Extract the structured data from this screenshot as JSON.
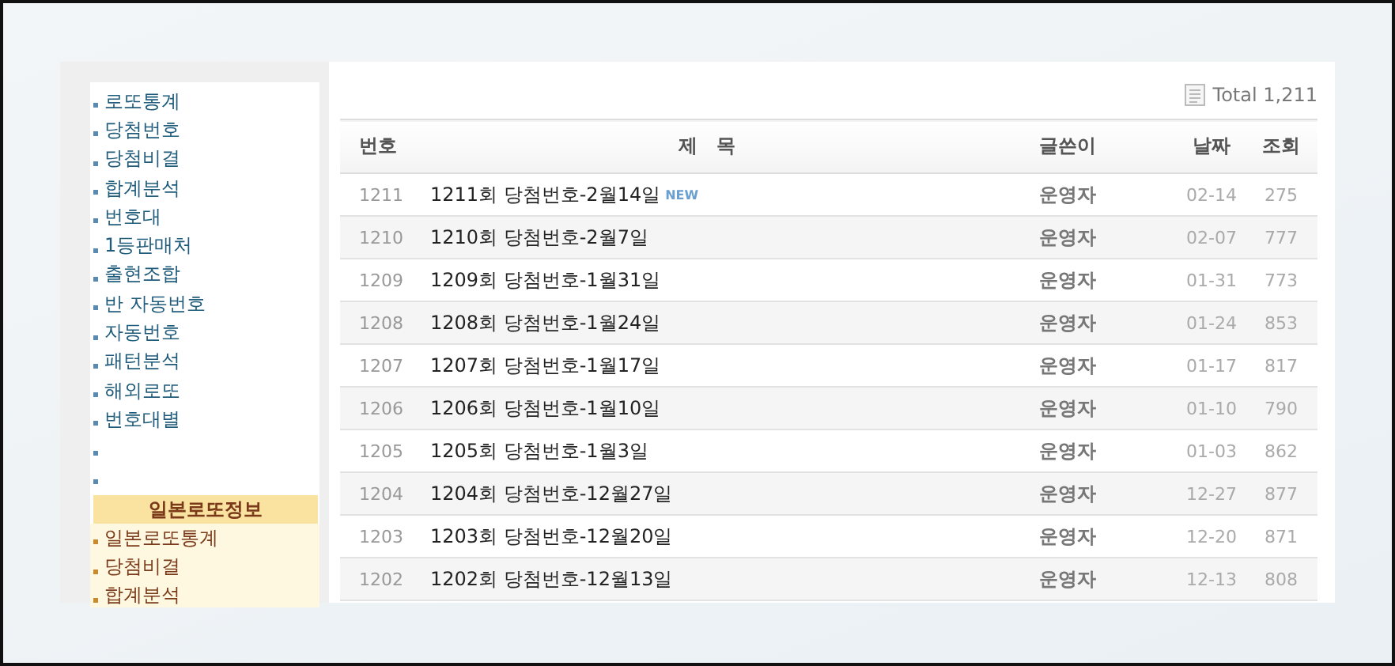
{
  "sidebar": {
    "items": [
      {
        "kind": "link",
        "label": "로또통계"
      },
      {
        "kind": "link",
        "label": "당첨번호"
      },
      {
        "kind": "link",
        "label": "당첨비결"
      },
      {
        "kind": "link",
        "label": "합계분석"
      },
      {
        "kind": "link",
        "label": "번호대"
      },
      {
        "kind": "link",
        "label": "1등판매처"
      },
      {
        "kind": "link",
        "label": "출현조합"
      },
      {
        "kind": "link",
        "label": "반 자동번호"
      },
      {
        "kind": "link",
        "label": "자동번호"
      },
      {
        "kind": "link",
        "label": "패턴분석"
      },
      {
        "kind": "link",
        "label": "해외로또"
      },
      {
        "kind": "link",
        "label": "번호대별"
      },
      {
        "kind": "blank"
      },
      {
        "kind": "blank"
      },
      {
        "kind": "header",
        "label": "일본로또정보"
      },
      {
        "kind": "sublink",
        "label": "일본로또통계"
      },
      {
        "kind": "sublink",
        "label": "당첨비결"
      },
      {
        "kind": "sublink",
        "label": "합계분석"
      }
    ]
  },
  "total": "Total 1,211",
  "table": {
    "columns": [
      "번호",
      "제　목",
      "글쓴이",
      "날짜",
      "조회"
    ],
    "rows": [
      {
        "no": "1211",
        "title": "1211회 당첨번호-2월14일",
        "badge": "NEW",
        "author": "운영자",
        "date": "02-14",
        "views": "275"
      },
      {
        "no": "1210",
        "title": "1210회 당첨번호-2월7일",
        "author": "운영자",
        "date": "02-07",
        "views": "777"
      },
      {
        "no": "1209",
        "title": "1209회 당첨번호-1월31일",
        "author": "운영자",
        "date": "01-31",
        "views": "773"
      },
      {
        "no": "1208",
        "title": "1208회 당첨번호-1월24일",
        "author": "운영자",
        "date": "01-24",
        "views": "853"
      },
      {
        "no": "1207",
        "title": "1207회 당첨번호-1월17일",
        "author": "운영자",
        "date": "01-17",
        "views": "817"
      },
      {
        "no": "1206",
        "title": "1206회 당첨번호-1월10일",
        "author": "운영자",
        "date": "01-10",
        "views": "790"
      },
      {
        "no": "1205",
        "title": "1205회 당첨번호-1월3일",
        "author": "운영자",
        "date": "01-03",
        "views": "862"
      },
      {
        "no": "1204",
        "title": "1204회 당첨번호-12월27일",
        "author": "운영자",
        "date": "12-27",
        "views": "877"
      },
      {
        "no": "1203",
        "title": "1203회 당첨번호-12월20일",
        "author": "운영자",
        "date": "12-20",
        "views": "871"
      },
      {
        "no": "1202",
        "title": "1202회 당첨번호-12월13일",
        "author": "운영자",
        "date": "12-13",
        "views": "808"
      }
    ]
  }
}
